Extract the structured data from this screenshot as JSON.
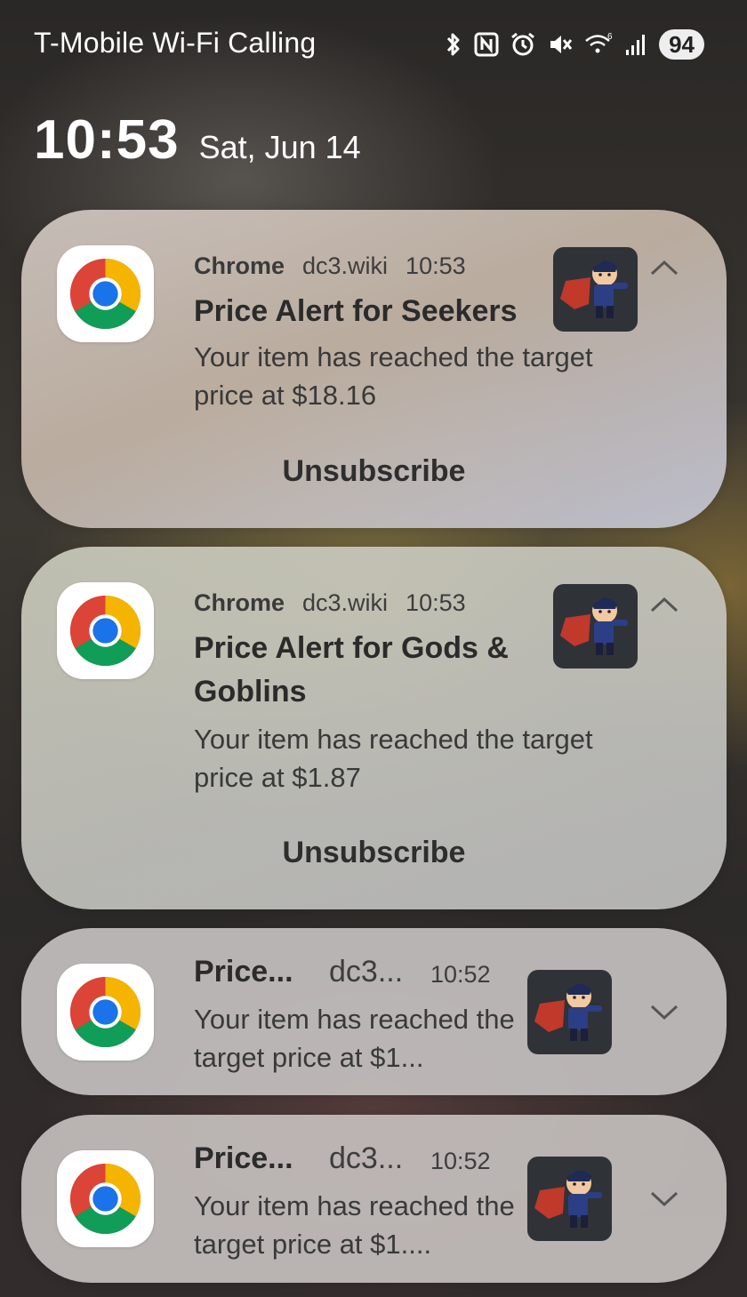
{
  "status_bar": {
    "carrier": "T-Mobile Wi-Fi Calling",
    "icons": [
      "bluetooth-icon",
      "nfc-icon",
      "alarm-icon",
      "mute-icon",
      "wifi-6-icon",
      "signal-icon"
    ],
    "battery": "94"
  },
  "lockscreen": {
    "time": "10:53",
    "date": "Sat, Jun 14"
  },
  "notifications": [
    {
      "app": "Chrome",
      "site": "dc3.wiki",
      "time": "10:53",
      "title": "Price Alert for Seekers",
      "body": "Your item has reached the target price at $18.16",
      "action": "Unsubscribe",
      "expanded": true
    },
    {
      "app": "Chrome",
      "site": "dc3.wiki",
      "time": "10:53",
      "title": "Price Alert for Gods & Goblins",
      "body": "Your item has reached the target price at $1.87",
      "action": "Unsubscribe",
      "expanded": true
    },
    {
      "title": "Price...",
      "site": "dc3...",
      "time": "10:52",
      "body": "Your item has reached the target price at $1...",
      "expanded": false
    },
    {
      "title": "Price...",
      "site": "dc3...",
      "time": "10:52",
      "body": "Your item has reached the target price at $1....",
      "expanded": false
    }
  ]
}
